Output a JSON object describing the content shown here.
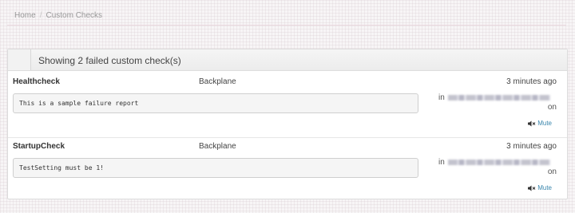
{
  "breadcrumb": {
    "home": "Home",
    "separator": "/",
    "current": "Custom Checks"
  },
  "panel": {
    "title": "Showing 2 failed custom check(s)"
  },
  "checks": [
    {
      "name": "Healthcheck",
      "category": "Backplane",
      "time": "3 minutes ago",
      "report": "This is a sample failure report",
      "in_label": "in",
      "on_label": "on",
      "mute_label": "Mute"
    },
    {
      "name": "StartupCheck",
      "category": "Backplane",
      "time": "3 minutes ago",
      "report": "TestSetting must be 1!",
      "in_label": "in",
      "on_label": "on",
      "mute_label": "Mute"
    }
  ],
  "icons": {
    "mute": "speaker-muted-icon"
  },
  "colors": {
    "link": "#3a87ad",
    "background": "#f7f5f6"
  }
}
